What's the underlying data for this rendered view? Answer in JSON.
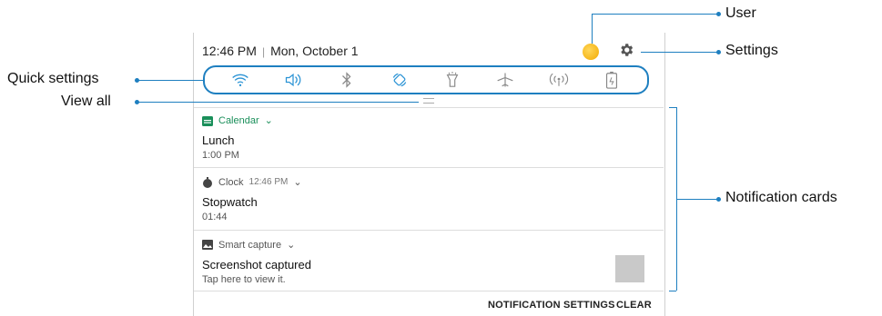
{
  "status_bar": {
    "time": "12:46 PM",
    "separator": "|",
    "date": "Mon, October 1"
  },
  "quick_settings": [
    {
      "icon": "wifi-icon"
    },
    {
      "icon": "sound-icon"
    },
    {
      "icon": "bluetooth-icon"
    },
    {
      "icon": "auto-rotate-icon"
    },
    {
      "icon": "flashlight-icon"
    },
    {
      "icon": "airplane-mode-icon"
    },
    {
      "icon": "mobile-hotspot-icon"
    },
    {
      "icon": "power-saving-icon"
    }
  ],
  "notifications": [
    {
      "app": "Calendar",
      "time": "",
      "title": "Lunch",
      "subtitle": "1:00 PM",
      "icon": "calendar-icon"
    },
    {
      "app": "Clock",
      "time": "12:46 PM",
      "title": "Stopwatch",
      "subtitle": "01:44",
      "icon": "clock-icon"
    },
    {
      "app": "Smart capture",
      "time": "",
      "title": "Screenshot captured",
      "subtitle": "Tap here to view it.",
      "icon": "image-icon"
    }
  ],
  "footer": {
    "notification_settings": "NOTIFICATION SETTINGS",
    "clear": "CLEAR"
  },
  "callouts": {
    "user": "User",
    "settings": "Settings",
    "quick_settings": "Quick settings",
    "view_all": "View all",
    "notification_cards": "Notification cards"
  },
  "colors": {
    "accent": "#1e7fc0",
    "avatar": "#f2b600"
  }
}
